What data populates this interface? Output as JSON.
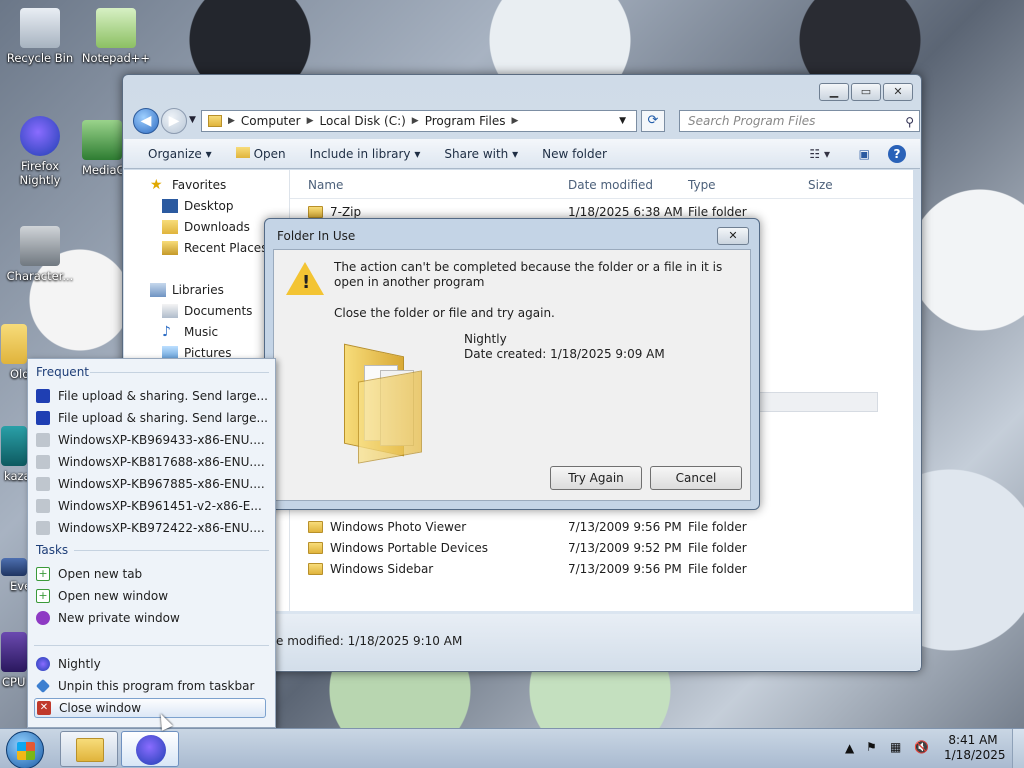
{
  "desktop": {
    "icons": [
      {
        "label": "Recycle Bin"
      },
      {
        "label": "Notepad++"
      },
      {
        "label": "Firefox Nightly"
      },
      {
        "label": "MediaC"
      },
      {
        "label": "Character..."
      },
      {
        "label": "Old"
      },
      {
        "label": "kaza"
      },
      {
        "label": "Eve"
      },
      {
        "label": "CPU"
      }
    ]
  },
  "explorer": {
    "breadcrumb": [
      "Computer",
      "Local Disk (C:)",
      "Program Files"
    ],
    "search_placeholder": "Search Program Files",
    "toolbar": {
      "organize": "Organize",
      "open": "Open",
      "include": "Include in library",
      "share": "Share with",
      "new_folder": "New folder"
    },
    "nav": {
      "favorites": "Favorites",
      "desktop": "Desktop",
      "downloads": "Downloads",
      "recent": "Recent Places",
      "libraries": "Libraries",
      "documents": "Documents",
      "music": "Music",
      "pictures": "Pictures"
    },
    "columns": {
      "name": "Name",
      "date": "Date modified",
      "type": "Type",
      "size": "Size"
    },
    "rows": [
      {
        "name": "7-Zip",
        "date": "1/18/2025 6:38 AM",
        "type": "File folder"
      },
      {
        "name": "Windows Photo Viewer",
        "date": "7/13/2009 9:56 PM",
        "type": "File folder"
      },
      {
        "name": "Windows Portable Devices",
        "date": "7/13/2009 9:52 PM",
        "type": "File folder"
      },
      {
        "name": "Windows Sidebar",
        "date": "7/13/2009 9:56 PM",
        "type": "File folder"
      }
    ],
    "status": "ate modified: 1/18/2025 9:10 AM"
  },
  "dialog": {
    "title": "Folder In Use",
    "message": "The action can't be completed because the folder or a file in it is open in another program",
    "hint": "Close the folder or file and try again.",
    "item_name": "Nightly",
    "item_date": "Date created: 1/18/2025 9:09 AM",
    "try_again": "Try Again",
    "cancel": "Cancel"
  },
  "jumplist": {
    "frequent_header": "Frequent",
    "frequent": [
      "File upload & sharing. Send large...",
      "File upload & sharing. Send large...",
      "WindowsXP-KB969433-x86-ENU....",
      "WindowsXP-KB817688-x86-ENU....",
      "WindowsXP-KB967885-x86-ENU....",
      "WindowsXP-KB961451-v2-x86-E...",
      "WindowsXP-KB972422-x86-ENU...."
    ],
    "tasks_header": "Tasks",
    "tasks": [
      "Open new tab",
      "Open new window",
      "New private window"
    ],
    "app": [
      "Nightly",
      "Unpin this program from taskbar",
      "Close window"
    ]
  },
  "taskbar": {
    "time": "8:41 AM",
    "date": "1/18/2025"
  }
}
